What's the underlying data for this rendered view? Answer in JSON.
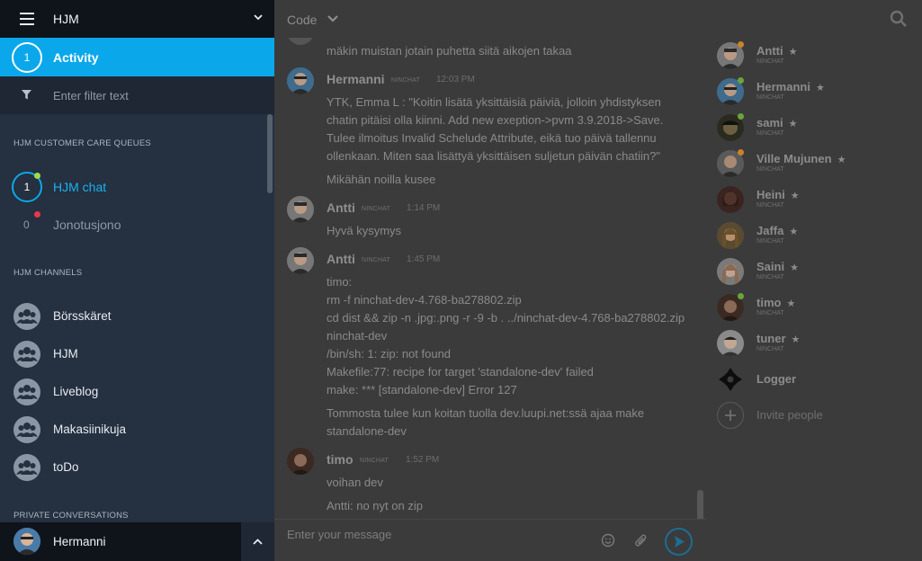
{
  "sidebar": {
    "org": "HJM",
    "activity": {
      "count": "1",
      "label": "Activity"
    },
    "filter_placeholder": "Enter filter text",
    "queues_header": "HJM CUSTOMER CARE QUEUES",
    "queues": [
      {
        "count": "1",
        "label": "HJM chat"
      },
      {
        "count": "0",
        "label": "Jonotusjono"
      }
    ],
    "channels_header": "HJM CHANNELS",
    "channels": [
      "Börsskäret",
      "HJM",
      "Liveblog",
      "Makasiinikuja",
      "toDo"
    ],
    "private_header": "PRIVATE CONVERSATIONS",
    "current_user": "Hermanni"
  },
  "topbar": {
    "channel": "Code"
  },
  "messages": [
    {
      "lines": [
        "mäkin muistan jotain puhetta siitä aikojen takaa"
      ]
    },
    {
      "name": "Hermanni",
      "tag": "NINCHAT",
      "time": "12:03 PM",
      "lines": [
        "YTK, Emma L : \"Koitin lisätä yksittäisiä päiviä, jolloin yhdistyksen",
        "chatin pitäisi olla kiinni. Add new exeption->pvm 3.9.2018->Save.",
        "Tulee ilmoitus Invalid Schelude Attribute, eikä tuo päivä tallennu",
        "ollenkaan. Miten saa lisättyä yksittäisen suljetun päivän chatiin?\"",
        "Mikähän noilla kusee"
      ]
    },
    {
      "name": "Antti",
      "tag": "NINCHAT",
      "time": "1:14 PM",
      "lines": [
        "Hyvä kysymys"
      ]
    },
    {
      "name": "Antti",
      "tag": "NINCHAT",
      "time": "1:45 PM",
      "lines": [
        "timo:",
        "rm -f ninchat-dev-4.768-ba278802.zip",
        "cd dist && zip -n .jpg:.png -r -9 -b . ../ninchat-dev-4.768-ba278802.zip",
        "ninchat-dev",
        "/bin/sh: 1: zip: not found",
        "Makefile:77: recipe for target 'standalone-dev' failed",
        "make: *** [standalone-dev] Error 127",
        "Tommosta tulee kun koitan tuolla dev.luupi.net:ssä ajaa make",
        "standalone-dev"
      ]
    },
    {
      "name": "timo",
      "tag": "NINCHAT",
      "time": "1:52 PM",
      "lines": [
        "voihan dev",
        "Antti: no nyt on zip"
      ]
    }
  ],
  "composer": {
    "placeholder": "Enter your message"
  },
  "members": [
    {
      "name": "Antti",
      "tag": "NINCHAT",
      "status": "#c9822a"
    },
    {
      "name": "Hermanni",
      "tag": "NINCHAT",
      "status": "#6aa53a"
    },
    {
      "name": "sami",
      "tag": "NINCHAT",
      "status": "#6aa53a"
    },
    {
      "name": "Ville Mujunen",
      "tag": "NINCHAT",
      "status": "#c9822a"
    },
    {
      "name": "Heini",
      "tag": "NINCHAT",
      "status": ""
    },
    {
      "name": "Jaffa",
      "tag": "NINCHAT",
      "status": ""
    },
    {
      "name": "Saini",
      "tag": "NINCHAT",
      "status": ""
    },
    {
      "name": "timo",
      "tag": "NINCHAT",
      "status": "#6aa53a"
    },
    {
      "name": "tuner",
      "tag": "NINCHAT",
      "status": ""
    }
  ],
  "logger": "Logger",
  "invite": "Invite people",
  "colors": {
    "accent": "#0aa8ea",
    "sidebar": "#253040",
    "dot_green": "#a8d84a",
    "dot_red": "#e8374f"
  }
}
